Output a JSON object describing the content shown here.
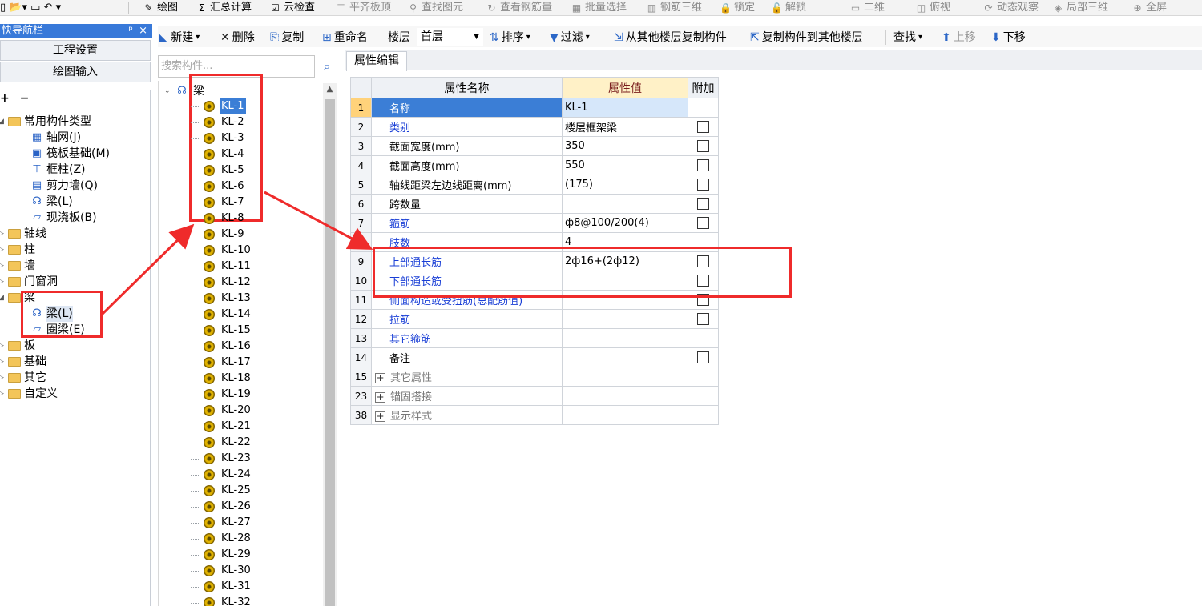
{
  "toolbar": {
    "items": [
      {
        "label": "绘图",
        "icon": "pencil-icon",
        "dim": false
      },
      {
        "label": "汇总计算",
        "icon": "sigma-icon",
        "dim": false
      },
      {
        "label": "云检查",
        "icon": "cloud-check-icon",
        "dim": false
      },
      {
        "label": "平齐板顶",
        "icon": "align-top-icon",
        "dim": true
      },
      {
        "label": "查找图元",
        "icon": "find-icon",
        "dim": true
      },
      {
        "label": "查看钢筋量",
        "icon": "rebar-view-icon",
        "dim": true
      },
      {
        "label": "批量选择",
        "icon": "batch-select-icon",
        "dim": true
      },
      {
        "label": "钢筋三维",
        "icon": "rebar-3d-icon",
        "dim": true
      },
      {
        "label": "锁定",
        "icon": "lock-icon",
        "dim": true
      },
      {
        "label": "解锁",
        "icon": "unlock-icon",
        "dim": true
      },
      {
        "label": "二维",
        "icon": "dropdown-icon",
        "dim": true
      },
      {
        "label": "俯视",
        "icon": "topview-icon",
        "dim": true
      },
      {
        "label": "动态观察",
        "icon": "orbit-icon",
        "dim": true
      },
      {
        "label": "局部三维",
        "icon": "local-3d-icon",
        "dim": true
      },
      {
        "label": "全屏",
        "icon": "fullscreen-icon",
        "dim": true
      }
    ]
  },
  "nav": {
    "title": "快导航栏",
    "pin": "ᵖ",
    "close": "×",
    "btn_project": "工程设置",
    "btn_draw": "绘图输入",
    "expand_tools": "+ −",
    "common_group": "常用构件类型",
    "common_items": [
      {
        "label": "轴网(J)",
        "icon": "grid-icon"
      },
      {
        "label": "筏板基础(M)",
        "icon": "raft-icon"
      },
      {
        "label": "框柱(Z)",
        "icon": "column-icon"
      },
      {
        "label": "剪力墙(Q)",
        "icon": "wall-icon"
      },
      {
        "label": "梁(L)",
        "icon": "beam-icon"
      },
      {
        "label": "现浇板(B)",
        "icon": "slab-icon"
      }
    ],
    "groups_before": [
      "轴线",
      "柱",
      "墙",
      "门窗洞"
    ],
    "beam_group": "梁",
    "beam_items": [
      {
        "label": "梁(L)",
        "icon": "beam-icon"
      },
      {
        "label": "圈梁(E)",
        "icon": "ring-beam-icon"
      }
    ],
    "groups_after": [
      "板",
      "基础",
      "其它",
      "自定义"
    ]
  },
  "component_list": {
    "search_placeholder": "搜索构件...",
    "root": "梁",
    "items": [
      "KL-1",
      "KL-2",
      "KL-3",
      "KL-4",
      "KL-5",
      "KL-6",
      "KL-7",
      "KL-8",
      "KL-9",
      "KL-10",
      "KL-11",
      "KL-12",
      "KL-13",
      "KL-14",
      "KL-15",
      "KL-16",
      "KL-17",
      "KL-18",
      "KL-19",
      "KL-20",
      "KL-21",
      "KL-22",
      "KL-23",
      "KL-24",
      "KL-25",
      "KL-26",
      "KL-27",
      "KL-28",
      "KL-29",
      "KL-30",
      "KL-31",
      "KL-32"
    ],
    "selected": "KL-1"
  },
  "props_toolbar": {
    "new": "新建",
    "delete": "删除",
    "copy": "复制",
    "rename": "重命名",
    "floor_label": "楼层",
    "floor_value": "首层",
    "sort": "排序",
    "filter": "过滤",
    "copy_from_floor": "从其他楼层复制构件",
    "copy_to_floor": "复制构件到其他楼层",
    "find": "查找",
    "move_up": "上移",
    "move_down": "下移"
  },
  "props": {
    "tab": "属性编辑",
    "headers": {
      "name": "属性名称",
      "value": "属性值",
      "extra": "附加"
    },
    "rows": [
      {
        "num": "1",
        "name": "名称",
        "value": "KL-1",
        "style": "sel",
        "checkbox": false
      },
      {
        "num": "2",
        "name": "类别",
        "value": "楼层框架梁",
        "style": "blue",
        "checkbox": true
      },
      {
        "num": "3",
        "name": "截面宽度(mm)",
        "value": "350",
        "style": "black",
        "checkbox": true
      },
      {
        "num": "4",
        "name": "截面高度(mm)",
        "value": "550",
        "style": "black",
        "checkbox": true
      },
      {
        "num": "5",
        "name": "轴线距梁左边线距离(mm)",
        "value": "(175)",
        "style": "black",
        "checkbox": true
      },
      {
        "num": "6",
        "name": "跨数量",
        "value": "",
        "style": "black",
        "checkbox": true
      },
      {
        "num": "7",
        "name": "箍筋",
        "value": "ф8@100/200(4)",
        "style": "blue",
        "checkbox": true
      },
      {
        "num": "8",
        "name": "肢数",
        "value": "4",
        "style": "blue",
        "checkbox": false
      },
      {
        "num": "9",
        "name": "上部通长筋",
        "value": "2ф16+(2ф12)",
        "style": "blue",
        "checkbox": true
      },
      {
        "num": "10",
        "name": "下部通长筋",
        "value": "",
        "style": "blue",
        "checkbox": true
      },
      {
        "num": "11",
        "name": "侧面构造或受扭筋(总配筋值)",
        "value": "",
        "style": "blue",
        "checkbox": true
      },
      {
        "num": "12",
        "name": "拉筋",
        "value": "",
        "style": "blue",
        "checkbox": true
      },
      {
        "num": "13",
        "name": "其它箍筋",
        "value": "",
        "style": "blue",
        "checkbox": false
      },
      {
        "num": "14",
        "name": "备注",
        "value": "",
        "style": "black",
        "checkbox": true
      },
      {
        "num": "15",
        "name": "其它属性",
        "value": "",
        "style": "group",
        "checkbox": false
      },
      {
        "num": "23",
        "name": "锚固搭接",
        "value": "",
        "style": "group",
        "checkbox": false
      },
      {
        "num": "38",
        "name": "显示样式",
        "value": "",
        "style": "group",
        "checkbox": false
      }
    ]
  },
  "colors": {
    "annotation": "#ef2b2b",
    "selection": "#3b7ed6",
    "link_text": "#1a3fd6",
    "nav_header": "#3879d9"
  }
}
